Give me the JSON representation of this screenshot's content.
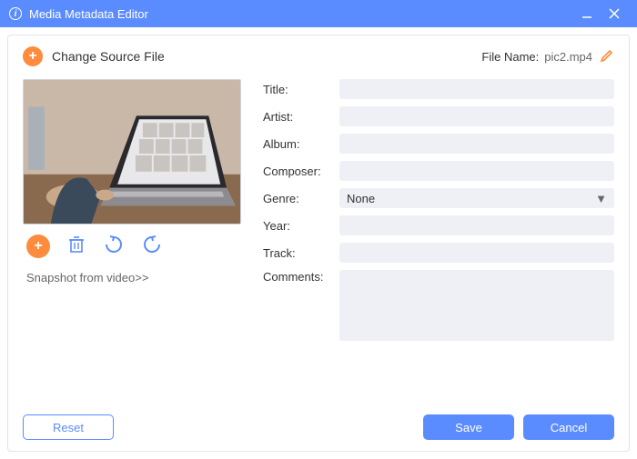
{
  "window": {
    "title": "Media Metadata Editor"
  },
  "header": {
    "change_source_label": "Change Source File",
    "file_name_label": "File Name:",
    "file_name_value": "pic2.mp4"
  },
  "snapshot_link": "Snapshot from video>>",
  "form": {
    "title_label": "Title:",
    "title_value": "",
    "artist_label": "Artist:",
    "artist_value": "",
    "album_label": "Album:",
    "album_value": "",
    "composer_label": "Composer:",
    "composer_value": "",
    "genre_label": "Genre:",
    "genre_value": "None",
    "year_label": "Year:",
    "year_value": "",
    "track_label": "Track:",
    "track_value": "",
    "comments_label": "Comments:",
    "comments_value": ""
  },
  "buttons": {
    "reset": "Reset",
    "save": "Save",
    "cancel": "Cancel"
  }
}
